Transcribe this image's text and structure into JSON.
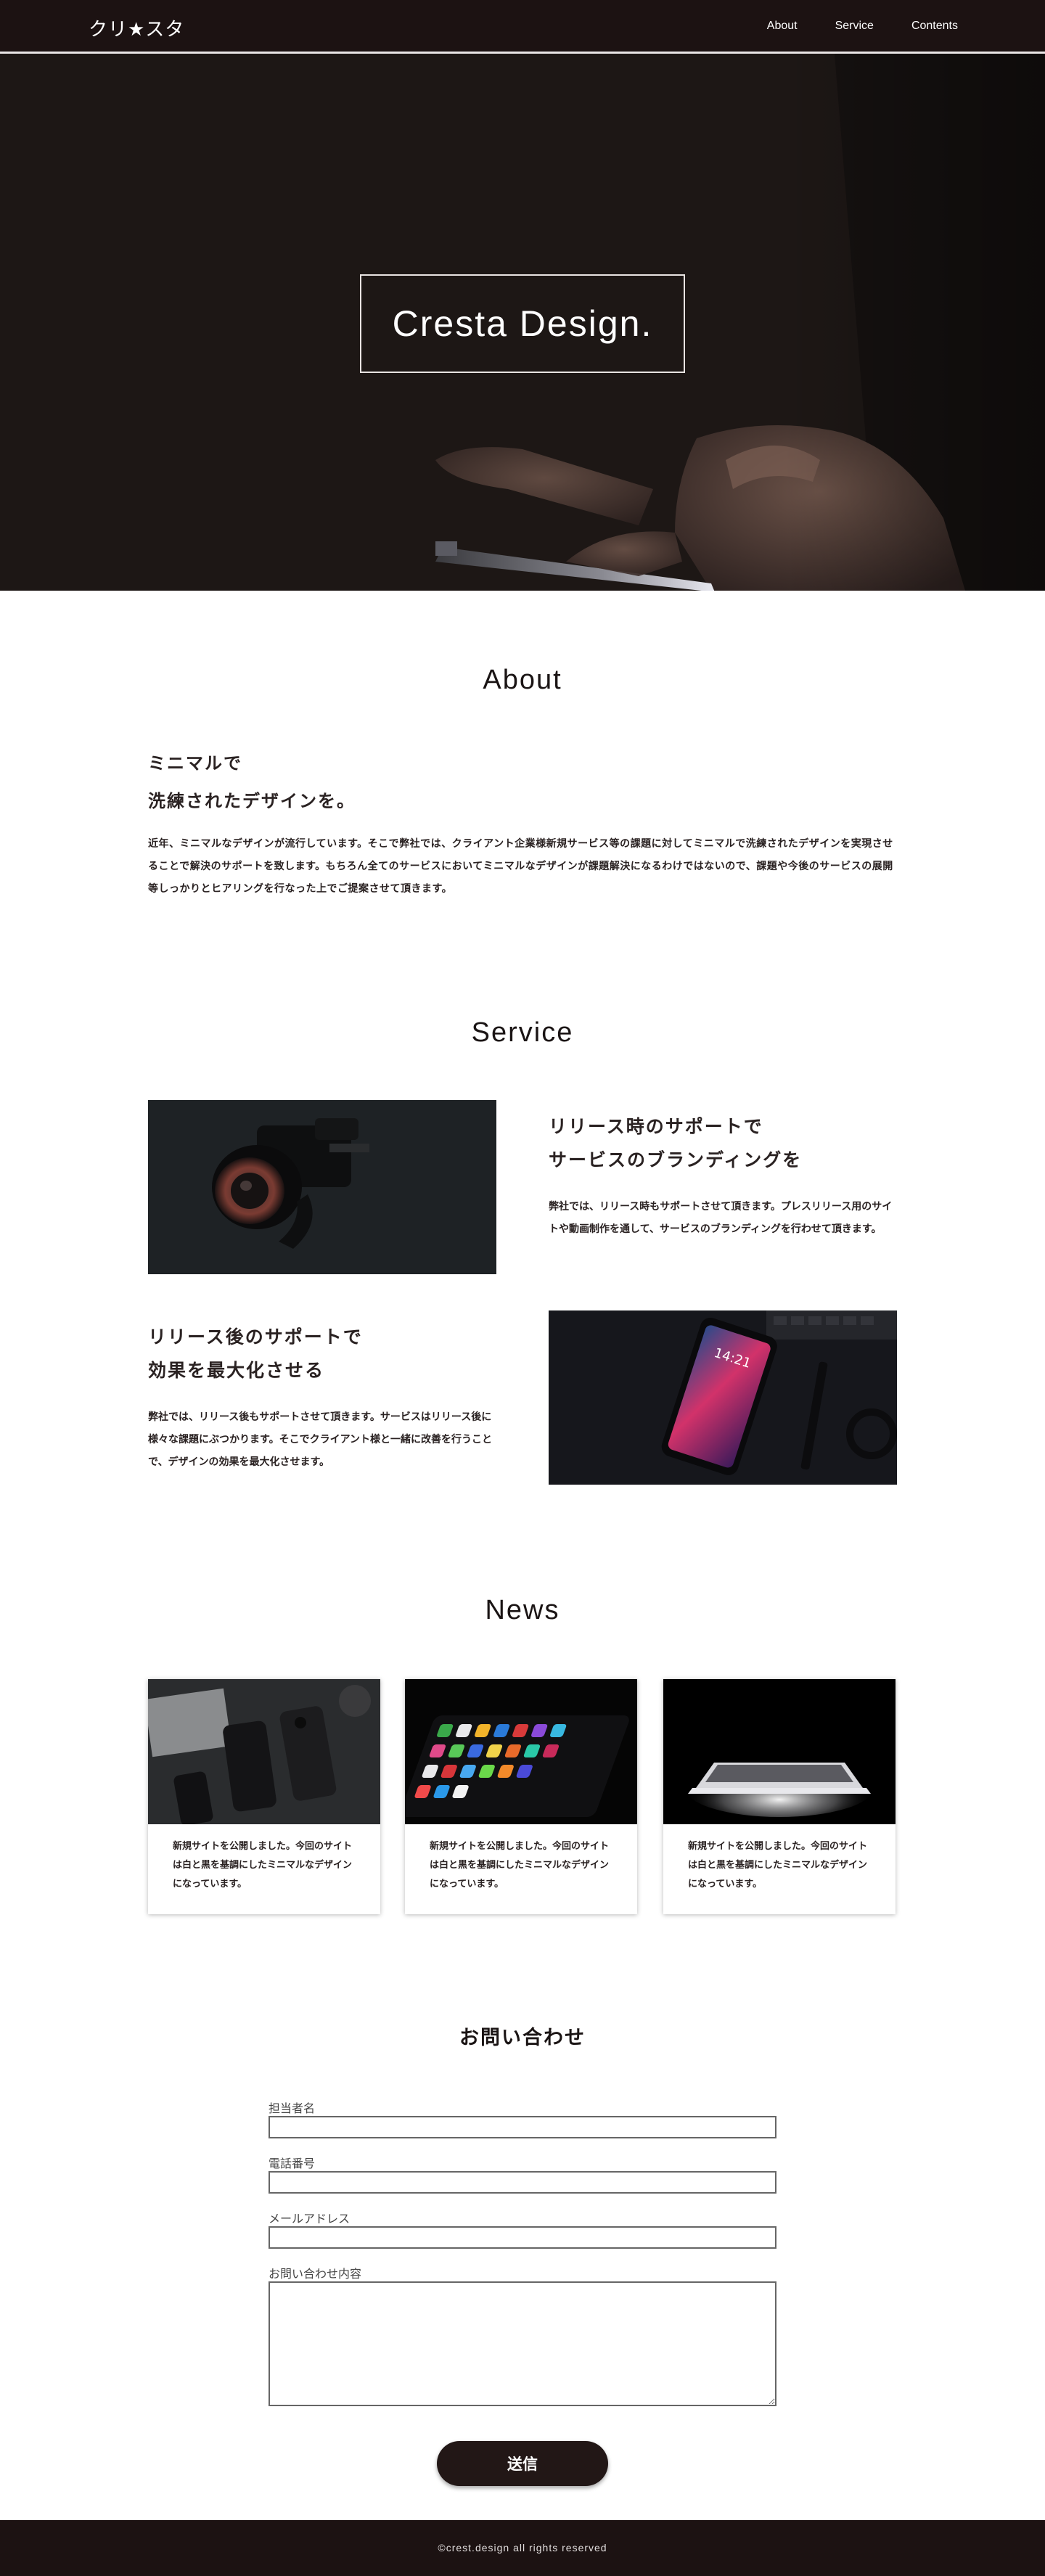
{
  "header": {
    "logo": "クリ★スタ",
    "nav": [
      "About",
      "Service",
      "Contents"
    ]
  },
  "hero": {
    "title": "Cresta Design."
  },
  "about": {
    "heading": "About",
    "subheading_line1": "ミニマルで",
    "subheading_line2": "洗練されたデザインを。",
    "body": "近年、ミニマルなデザインが流行しています。そこで弊社では、クライアント企業様新規サービス等の課題に対してミニマルで洗練されたデザインを実現させることで解決のサポートを致します。もちろん全てのサービスにおいてミニマルなデザインが課題解決になるわけではないので、課題や今後のサービスの展開等しっかりとヒアリングを行なった上でご提案させて頂きます。"
  },
  "service": {
    "heading": "Service",
    "items": [
      {
        "title_line1": "リリース時のサポートで",
        "title_line2": "サービスのブランディングを",
        "text": "弊社では、リリース時もサポートさせて頂きます。プレスリリース用のサイトや動画制作を通して、サービスのブランディングを行わせて頂きます。",
        "image_icon": "camera-photo-icon"
      },
      {
        "title_line1": "リリース後のサポートで",
        "title_line2": "効果を最大化させる",
        "text": "弊社では、リリース後もサポートさせて頂きます。サービスはリリース後に様々な課題にぶつかります。そこでクライアント様と一緒に改善を行うことで、デザインの効果を最大化させます。",
        "image_icon": "smartphone-photo-icon"
      }
    ]
  },
  "news": {
    "heading": "News",
    "cards": [
      {
        "text": "新規サイトを公開しました。今回のサイトは白と黒を基調にしたミニマルなデザインになっています。",
        "image_icon": "phones-photo-icon"
      },
      {
        "text": "新規サイトを公開しました。今回のサイトは白と黒を基調にしたミニマルなデザインになっています。",
        "image_icon": "app-icons-photo-icon"
      },
      {
        "text": "新規サイトを公開しました。今回のサイトは白と黒を基調にしたミニマルなデザインになっています。",
        "image_icon": "laptop-photo-icon"
      }
    ]
  },
  "contact": {
    "heading": "お問い合わせ",
    "fields": [
      {
        "label": "担当者名",
        "value": ""
      },
      {
        "label": "電話番号",
        "value": ""
      },
      {
        "label": "メールアドレス",
        "value": ""
      },
      {
        "label": "お問い合わせ内容",
        "value": ""
      }
    ],
    "submit_label": "送信"
  },
  "footer": {
    "copyright": "©crest.design all rights reserved"
  },
  "colors": {
    "header_bg": "#1c1212",
    "hero_bg": "#1d1715",
    "button_bg": "#221716"
  }
}
